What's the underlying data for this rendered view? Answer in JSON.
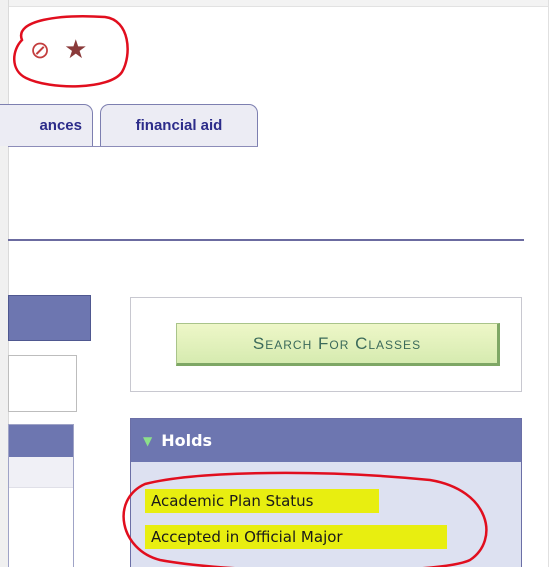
{
  "toolbar": {
    "icons": [
      {
        "name": "no-entry-icon",
        "glyph": "⊘"
      },
      {
        "name": "star-icon",
        "glyph": "★"
      }
    ]
  },
  "tabs": [
    {
      "label": "ances"
    },
    {
      "label": "financial aid"
    }
  ],
  "search": {
    "button_label": "Search For Classes"
  },
  "holds": {
    "title": "Holds",
    "items": [
      {
        "label": "Academic Plan Status"
      },
      {
        "label": "Accepted in Official Major"
      }
    ]
  },
  "colors": {
    "accent": "#6d76b0",
    "annotation": "#e10e1e",
    "highlight": "#e8ee10",
    "button_bg": "#d6ebb0"
  }
}
